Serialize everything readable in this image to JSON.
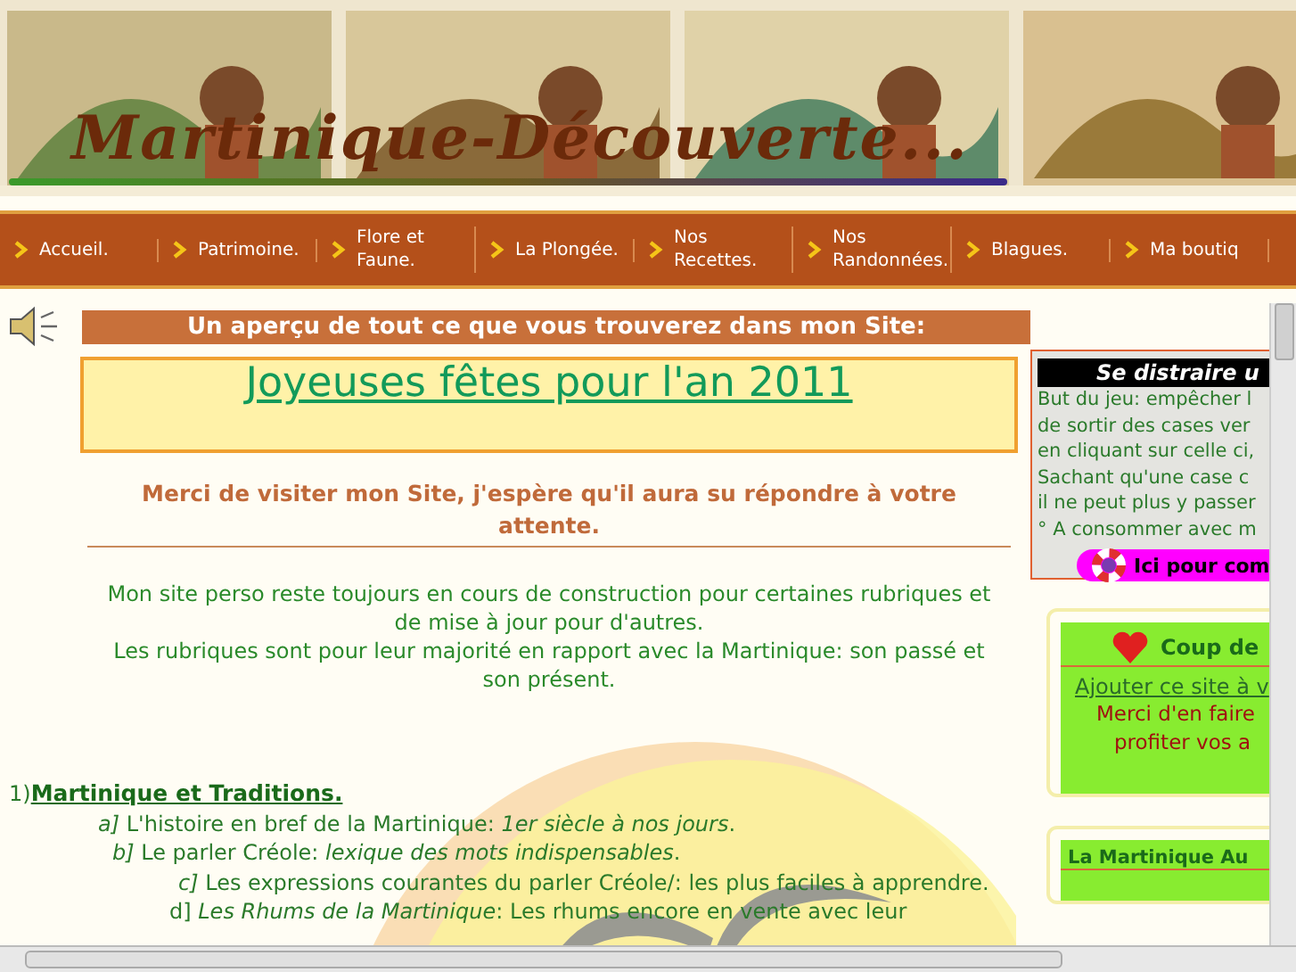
{
  "banner": {
    "kind": "picture",
    "logo": "Martinique-Découverte..."
  },
  "nav": [
    {
      "label": "Accueil."
    },
    {
      "label": "Patrimoine."
    },
    {
      "label": "Flore et Faune."
    },
    {
      "label": "La Plongée."
    },
    {
      "label": "Nos Recettes."
    },
    {
      "label": "Nos Randonnées."
    },
    {
      "label": "Blagues."
    },
    {
      "label": "Ma boutiq"
    }
  ],
  "heading": "Un aperçu de tout ce que vous trouverez dans mon Site:",
  "greeting": "Joyeuses fêtes pour l'an 2011",
  "thanks": "Merci de visiter mon Site, j'espère qu'il aura su répondre à votre attente.",
  "intro": [
    "Mon site  perso reste toujours en cours de construction pour certaines rubriques et de mise à jour pour d'autres.",
    "Les rubriques sont pour leur majorité en rapport avec la Martinique: son passé et son présent."
  ],
  "section": {
    "number": "1)",
    "title": "Martinique et Traditions.",
    "items": [
      "*a]* L'histoire en bref de la Martinique: *1er siècle à nos jours*.",
      "*b]* Le parler Créole: *lexique des mots indispensables*.",
      "*c]* Les expressions courantes du parler Créole/: les plus faciles à apprendre.",
      "d] *Les Rhums de la Martinique*: Les rhums encore en vente avec leur"
    ]
  },
  "game": {
    "title": "Se distraire u",
    "lines": [
      "But du jeu: empêcher l",
      "de sortir des cases ver",
      "en cliquant sur celle ci,",
      "Sachant qu'une case c",
      "il ne peut plus y passer",
      "° A consommer avec m"
    ],
    "button": "Ici pour com"
  },
  "favorite": {
    "title": "Coup de",
    "link": "Ajouter ce site à v",
    "lines": [
      "Merci d'en faire",
      "profiter vos a"
    ]
  },
  "martinique_box": {
    "title": "La Martinique Au"
  }
}
